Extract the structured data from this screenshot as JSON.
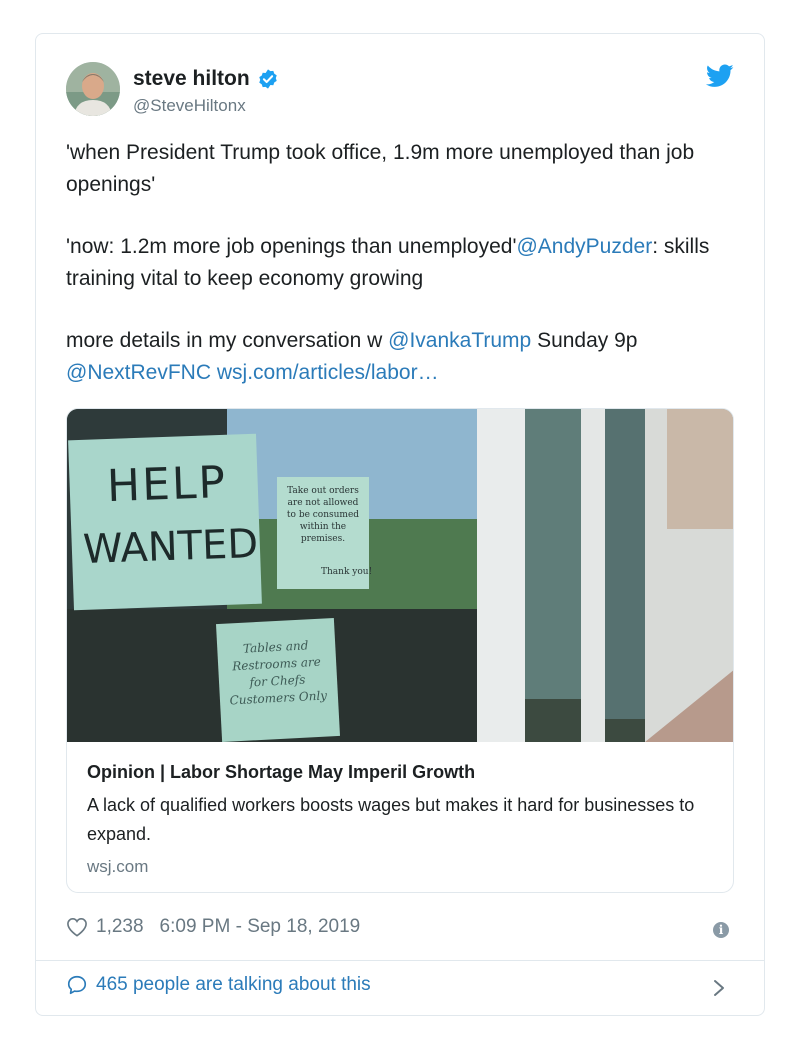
{
  "tweet": {
    "author_name": "steve hilton",
    "author_handle": "@SteveHiltonx",
    "verified": true,
    "line1": "'when President Trump took office, 1.9m more unemployed than job openings'",
    "line2_text": "'now: 1.2m more job openings than unemployed'",
    "mention1": "@AndyPuzder",
    "line2_tail": ": skills training vital to keep economy growing",
    "line3_text": "more details in my conversation w ",
    "mention2": "@IvankaTrump",
    "line3_mid": " Sunday 9p ",
    "mention3": "@NextRevFNC",
    "url_text": "wsj.com/articles/labor…"
  },
  "card": {
    "photo_sign_help": "HELP",
    "photo_sign_wanted": "WANTED",
    "photo_sign_takeout": "Take out orders are not allowed to be consumed within the premises.",
    "photo_sign_thanks": "Thank you!",
    "photo_sign_tables": "Tables and Restrooms are for Chefs Customers Only",
    "title": "Opinion | Labor Shortage May Imperil Growth",
    "description": "A lack of qualified workers boosts wages but makes it hard for businesses to expand.",
    "domain": "wsj.com"
  },
  "footer": {
    "likes": "1,238",
    "timestamp": "6:09 PM - Sep 18, 2019",
    "talking": "465 people are talking about this"
  },
  "colors": {
    "link": "#2b7bb9",
    "verified": "#1da1f2",
    "twitter_blue": "#1da1f2"
  },
  "icons": [
    "avatar",
    "verified-icon",
    "twitter-bird-icon",
    "heart-icon",
    "info-icon",
    "speech-bubble-icon",
    "chevron-right-icon"
  ]
}
